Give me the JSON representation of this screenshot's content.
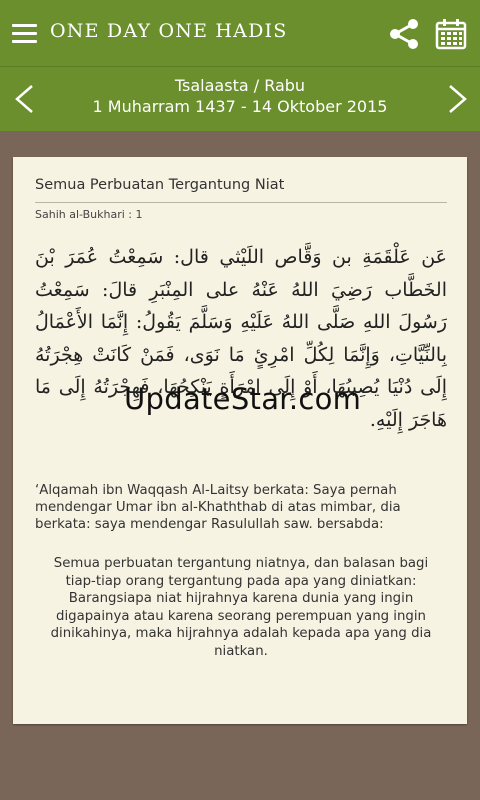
{
  "appbar": {
    "title": "ONE DAY ONE HADIS",
    "menu_icon": "hamburger-menu-icon",
    "share_icon": "share-icon",
    "calendar_icon": "calendar-icon",
    "background_color": "#6a8f2c"
  },
  "datebar": {
    "day": "Tsalaasta / Rabu",
    "date": "1 Muharram 1437 - 14 Oktober 2015",
    "prev_icon": "chevron-left-icon",
    "next_icon": "chevron-right-icon"
  },
  "hadith": {
    "title": "Semua Perbuatan Tergantung Niat",
    "source": "Sahih al-Bukhari : 1",
    "arabic": "عَن عَلْقَمَةِ بن وَقَّاص اللَيْثي قال: سَمِعْتُ عُمَرَ بْنَ الخَطَّاب رَضِيَ اللهُ عَنْهُ على المِنْبَرِ قالَ: سَمِعْتُ رَسُولَ اللهِ صَلَّى اللهُ عَلَيْهِ وَسَلَّمَ يَقُولُ: إِنَّمَا الأَعْمَالُ بِالنِّيَّاتِ، وَإِنَّمَا لِكُلِّ امْرِئٍ مَا نَوَى، فَمَنْ كَانَتْ هِجْرَتُهُ إِلَى دُنْيَا يُصِيبُهَا، أَوْ إِلَى امْرَأَةٍ يَنْكِحُهَا، فَهِجْرَتُهُ إِلَى مَا هَاجَرَ إِلَيْهِ.",
    "translation_intro": "‘Alqamah ibn Waqqash Al-Laitsy berkata: Saya pernah mendengar Umar ibn al-Khaththab di atas mimbar, dia berkata: saya mendengar Rasulullah saw. bersabda:",
    "translation": "Semua perbuatan tergantung niatnya, dan balasan bagi tiap-tiap orang tergantung pada apa yang diniatkan: Barangsiapa niat hijrahnya karena dunia yang ingin digapainya atau karena seorang perempuan yang ingin dinikahinya, maka hijrahnya adalah kepada apa yang dia niatkan."
  },
  "watermark": "UpdateStar.com"
}
